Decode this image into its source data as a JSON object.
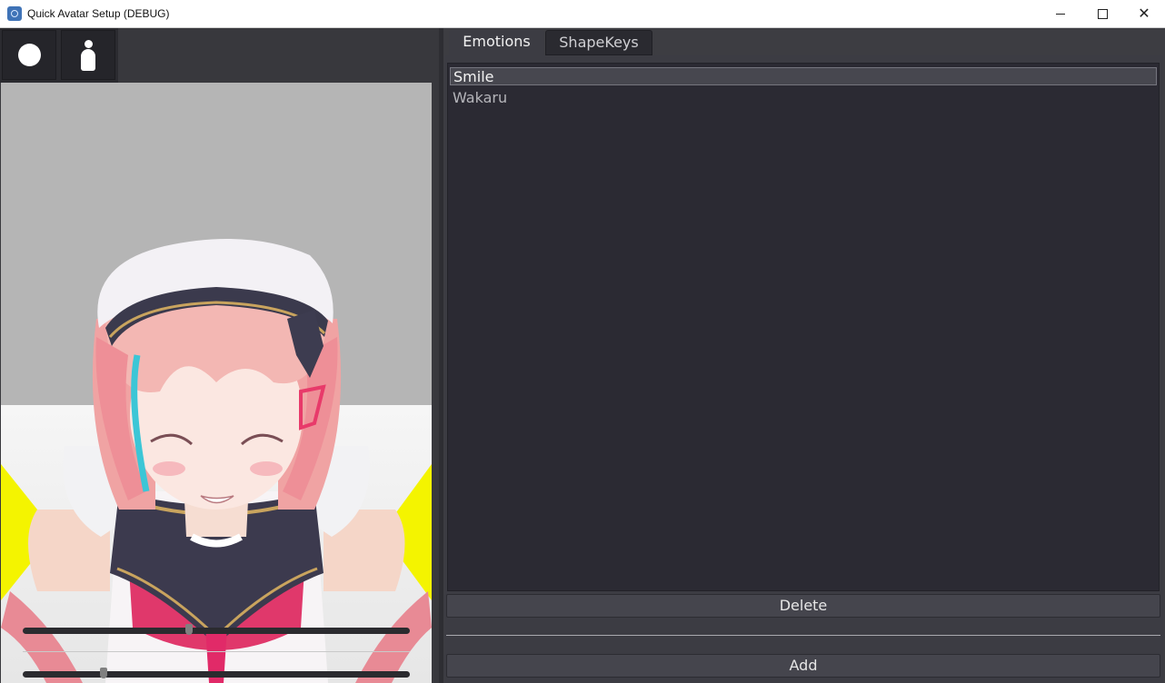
{
  "window": {
    "title": "Quick Avatar Setup (DEBUG)",
    "icon": "godot-app-icon",
    "controls": [
      "minimize-icon",
      "maximize-icon",
      "close-icon"
    ],
    "close_glyph": "✕"
  },
  "toolbar": {
    "buttons": [
      {
        "icon": "circle-icon"
      },
      {
        "icon": "person-icon"
      }
    ]
  },
  "viewport": {
    "background_color": "#b5b5b5",
    "light_color": "#f4f400",
    "sliders": [
      {
        "value": 0.43
      },
      {
        "value": 0.21
      }
    ]
  },
  "tabs": [
    {
      "label": "Emotions",
      "active": true
    },
    {
      "label": "ShapeKeys",
      "active": false
    }
  ],
  "emotions": {
    "items": [
      {
        "label": "Smile",
        "selected": true
      },
      {
        "label": "Wakaru",
        "selected": false
      }
    ],
    "delete_label": "Delete",
    "new_name_value": "",
    "add_label": "Add"
  }
}
